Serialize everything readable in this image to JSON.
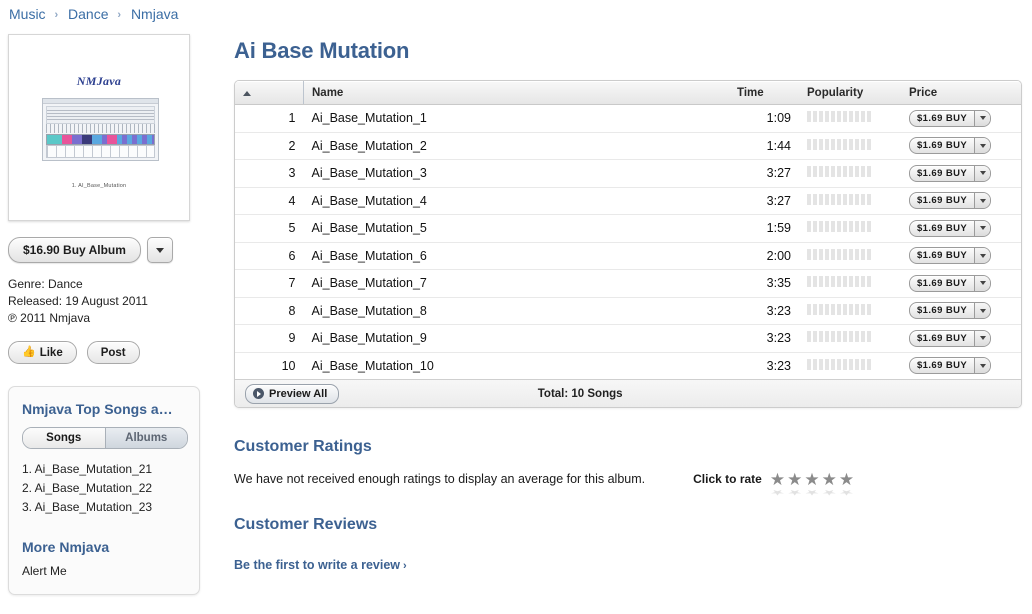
{
  "breadcrumb": {
    "items": [
      "Music",
      "Dance",
      "Nmjava"
    ],
    "separator": "›"
  },
  "album": {
    "title": "Ai Base Mutation",
    "art_title": "NMJava",
    "art_track_caption": "1.  AI_Base_Mutation",
    "buy_album_label": "$16.90 Buy Album",
    "genre": "Genre: Dance",
    "released": "Released: 19 August 2011",
    "copyright": "℗ 2011 Nmjava"
  },
  "social": {
    "like_label": "Like",
    "post_label": "Post",
    "thumb_icon": "thumbs-up-icon"
  },
  "sidebar": {
    "panel_title": "Nmjava Top Songs a…",
    "segments": [
      {
        "label": "Songs",
        "selected": true
      },
      {
        "label": "Albums",
        "selected": false
      }
    ],
    "top_songs": [
      "1. Ai_Base_Mutation_21",
      "2. Ai_Base_Mutation_22",
      "3. Ai_Base_Mutation_23"
    ],
    "more_title": "More Nmjava",
    "more_links": [
      "Alert Me"
    ]
  },
  "tracklist": {
    "columns": {
      "number": "",
      "name": "Name",
      "time": "Time",
      "popularity": "Popularity",
      "price": "Price"
    },
    "sort_indicator": "sort-ascending-icon",
    "rows": [
      {
        "num": "1",
        "name": "Ai_Base_Mutation_1",
        "time": "1:09",
        "price": "$1.69  BUY"
      },
      {
        "num": "2",
        "name": "Ai_Base_Mutation_2",
        "time": "1:44",
        "price": "$1.69  BUY"
      },
      {
        "num": "3",
        "name": "Ai_Base_Mutation_3",
        "time": "3:27",
        "price": "$1.69  BUY"
      },
      {
        "num": "4",
        "name": "Ai_Base_Mutation_4",
        "time": "3:27",
        "price": "$1.69  BUY"
      },
      {
        "num": "5",
        "name": "Ai_Base_Mutation_5",
        "time": "1:59",
        "price": "$1.69  BUY"
      },
      {
        "num": "6",
        "name": "Ai_Base_Mutation_6",
        "time": "2:00",
        "price": "$1.69  BUY"
      },
      {
        "num": "7",
        "name": "Ai_Base_Mutation_7",
        "time": "3:35",
        "price": "$1.69  BUY"
      },
      {
        "num": "8",
        "name": "Ai_Base_Mutation_8",
        "time": "3:23",
        "price": "$1.69  BUY"
      },
      {
        "num": "9",
        "name": "Ai_Base_Mutation_9",
        "time": "3:23",
        "price": "$1.69  BUY"
      },
      {
        "num": "10",
        "name": "Ai_Base_Mutation_10",
        "time": "3:23",
        "price": "$1.69  BUY"
      }
    ],
    "footer": {
      "preview_label": "Preview All",
      "total": "Total: 10 Songs"
    }
  },
  "ratings": {
    "title": "Customer Ratings",
    "message": "We have not received enough ratings to display an average for this album.",
    "click_to_rate": "Click to rate",
    "star_count": 5
  },
  "reviews": {
    "title": "Customer Reviews",
    "link": "Be the first to write a review",
    "chevron": "›"
  },
  "colors": {
    "accent_blue": "#3c6191",
    "link_blue": "#3b6ea5",
    "art_title_blue": "#2c3f8f"
  }
}
